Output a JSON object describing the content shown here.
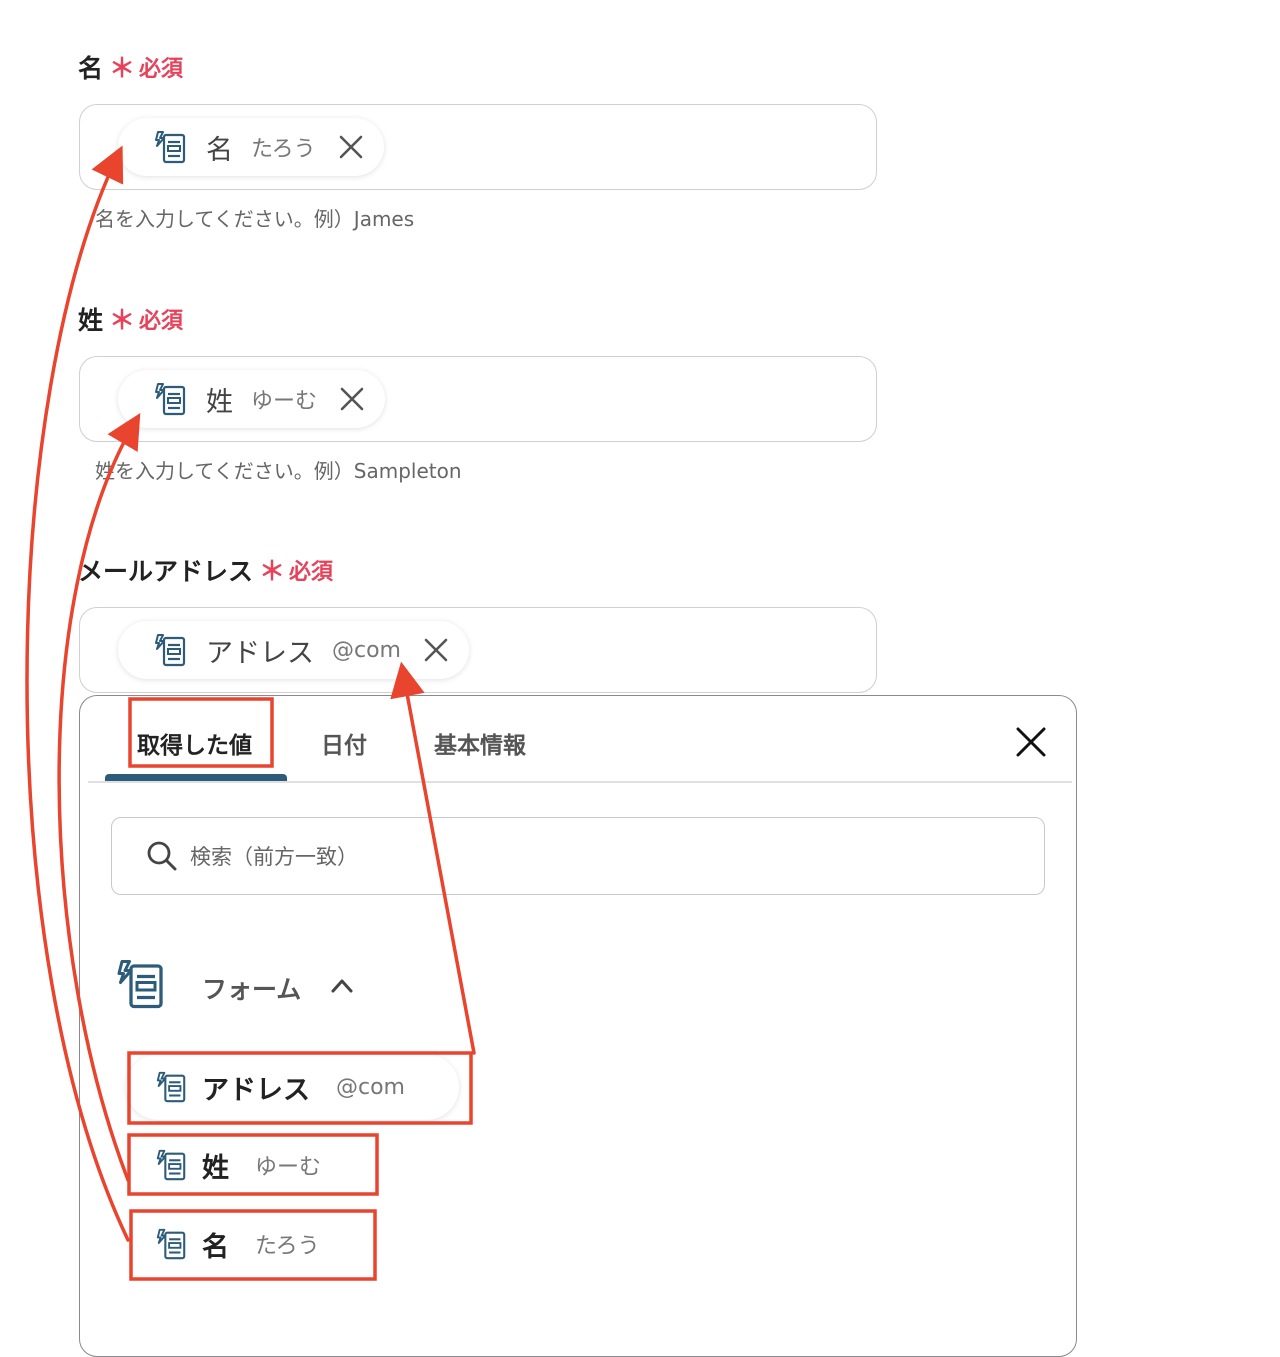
{
  "fields": [
    {
      "label": "名",
      "required_star": "＊",
      "required_text": "必須",
      "chip_name": "名",
      "chip_value": "たろう",
      "hint": "名を入力してください。例）James"
    },
    {
      "label": "姓",
      "required_star": "＊",
      "required_text": "必須",
      "chip_name": "姓",
      "chip_value": "ゆーむ",
      "hint": "姓を入力してください。例）Sampleton"
    },
    {
      "label": "メールアドレス",
      "required_star": "＊",
      "required_text": "必須",
      "chip_name": "アドレス",
      "chip_value": "@com",
      "hint": ""
    }
  ],
  "panel": {
    "tabs": [
      "取得した値",
      "日付",
      "基本情報"
    ],
    "active_tab": 0,
    "search_placeholder": "検索（前方一致）",
    "group_label": "フォーム",
    "items": [
      {
        "name": "アドレス",
        "value": "@com"
      },
      {
        "name": "姓",
        "value": "ゆーむ"
      },
      {
        "name": "名",
        "value": "たろう"
      }
    ]
  },
  "colors": {
    "required": "#e8425a",
    "annotation": "#e8442e",
    "tab_accent": "#2d5c7a",
    "icon": "#2d5c7a"
  },
  "icons": [
    "form-icon",
    "close-icon",
    "search-icon",
    "chevron-up-icon"
  ]
}
